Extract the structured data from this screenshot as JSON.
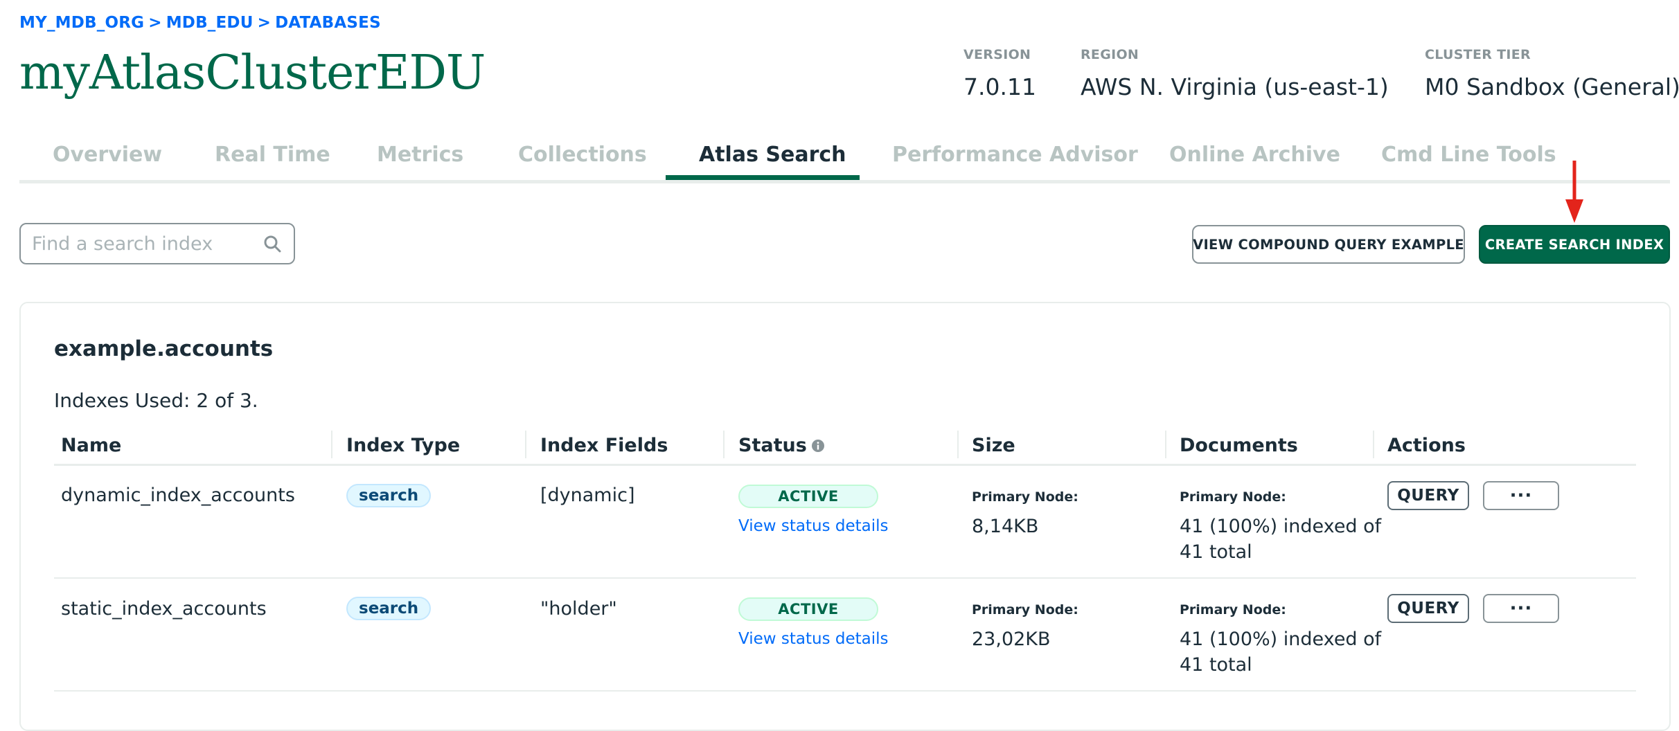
{
  "breadcrumb": {
    "org": "MY_MDB_ORG",
    "project": "MDB_EDU",
    "section": "DATABASES",
    "separator": ">"
  },
  "cluster": {
    "name": "myAtlasClusterEDU",
    "version_label": "VERSION",
    "version": "7.0.11",
    "region_label": "REGION",
    "region": "AWS N. Virginia (us-east-1)",
    "tier_label": "CLUSTER TIER",
    "tier": "M0 Sandbox (General)"
  },
  "tabs": [
    {
      "label": "Overview",
      "active": false
    },
    {
      "label": "Real Time",
      "active": false
    },
    {
      "label": "Metrics",
      "active": false
    },
    {
      "label": "Collections",
      "active": false
    },
    {
      "label": "Atlas Search",
      "active": true
    },
    {
      "label": "Performance Advisor",
      "active": false
    },
    {
      "label": "Online Archive",
      "active": false
    },
    {
      "label": "Cmd Line Tools",
      "active": false
    }
  ],
  "toolbar": {
    "search_placeholder": "Find a search index",
    "compound_button": "VIEW COMPOUND QUERY EXAMPLE",
    "create_button": "CREATE SEARCH INDEX"
  },
  "collection": {
    "name": "example.accounts",
    "indexes_used": "Indexes Used: 2 of 3."
  },
  "table": {
    "headers": [
      "Name",
      "Index Type",
      "Index Fields",
      "Status",
      "Size",
      "Documents",
      "Actions"
    ],
    "rows": [
      {
        "name": "dynamic_index_accounts",
        "type": "search",
        "fields": "[dynamic]",
        "status": "ACTIVE",
        "status_link": "View status details",
        "size_label": "Primary Node:",
        "size": "8,14KB",
        "docs_label": "Primary Node:",
        "docs_line1": "41 (100%) indexed of",
        "docs_line2": "41 total",
        "query": "QUERY",
        "more": "···"
      },
      {
        "name": "static_index_accounts",
        "type": "search",
        "fields": "\"holder\"",
        "status": "ACTIVE",
        "status_link": "View status details",
        "size_label": "Primary Node:",
        "size": "23,02KB",
        "docs_label": "Primary Node:",
        "docs_line1": "41 (100%) indexed of",
        "docs_line2": "41 total",
        "query": "QUERY",
        "more": "···"
      }
    ]
  },
  "colors": {
    "brand_green": "#00684a",
    "link_blue": "#016bf8",
    "annotation_red": "#e3241b"
  },
  "icons": {
    "search": "search-icon",
    "info": "info-icon",
    "arrow": "red-arrow-down-icon"
  }
}
